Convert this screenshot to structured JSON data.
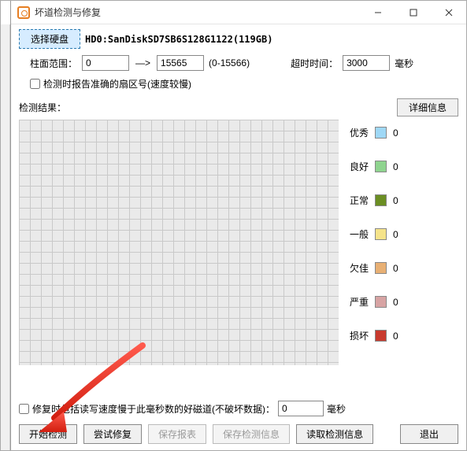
{
  "window": {
    "title": "坏道检测与修复",
    "select_disk": "选择硬盘",
    "disk_name": "HD0:SanDiskSD7SB6S128G1122(119GB)",
    "cylinder_label": "柱面范围：",
    "cyl_start": "0",
    "cyl_arrow": "—>",
    "cyl_end": "15565",
    "cyl_range_hint": "(0-15566)",
    "timeout_label": "超时时间：",
    "timeout_value": "3000",
    "timeout_unit": "毫秒",
    "report_sector_checkbox": "检测时报告准确的扇区号(速度较慢)",
    "result_label": "检测结果：",
    "detail_btn": "详细信息",
    "legend": [
      {
        "label": "优秀",
        "cls": "c-exc",
        "count": "0"
      },
      {
        "label": "良好",
        "cls": "c-good",
        "count": "0"
      },
      {
        "label": "正常",
        "cls": "c-norm",
        "count": "0"
      },
      {
        "label": "一般",
        "cls": "c-fair",
        "count": "0"
      },
      {
        "label": "欠佳",
        "cls": "c-poor",
        "count": "0"
      },
      {
        "label": "严重",
        "cls": "c-sev",
        "count": "0"
      },
      {
        "label": "损坏",
        "cls": "c-bad",
        "count": "0"
      }
    ],
    "repair_checkbox_pre": "修复时包括读写速度慢于此毫秒数的好磁道(不破坏数据)：",
    "repair_ms": "0",
    "repair_unit": "毫秒",
    "buttons": {
      "start": "开始检测",
      "try_repair": "尝试修复",
      "save_report": "保存报表",
      "save_info": "保存检测信息",
      "read_info": "读取检测信息",
      "exit": "退出"
    }
  }
}
